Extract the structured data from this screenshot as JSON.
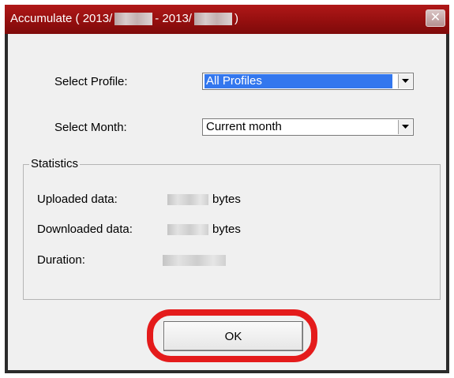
{
  "window": {
    "title_prefix": "Accumulate ( 2013/",
    "title_middle": " - 2013/",
    "title_suffix": " )",
    "close_glyph": "✕"
  },
  "form": {
    "profile_label": "Select Profile:",
    "profile_value": "All Profiles",
    "month_label": "Select Month:",
    "month_value": "Current month"
  },
  "statistics": {
    "legend": "Statistics",
    "uploaded_label": "Uploaded data:",
    "uploaded_unit": "bytes",
    "downloaded_label": "Downloaded data:",
    "downloaded_unit": "bytes",
    "duration_label": "Duration:"
  },
  "buttons": {
    "ok_label": "OK"
  },
  "colors": {
    "titlebar": "#9a1010",
    "selection": "#3377ee",
    "highlight_ring": "#e41b1b"
  }
}
